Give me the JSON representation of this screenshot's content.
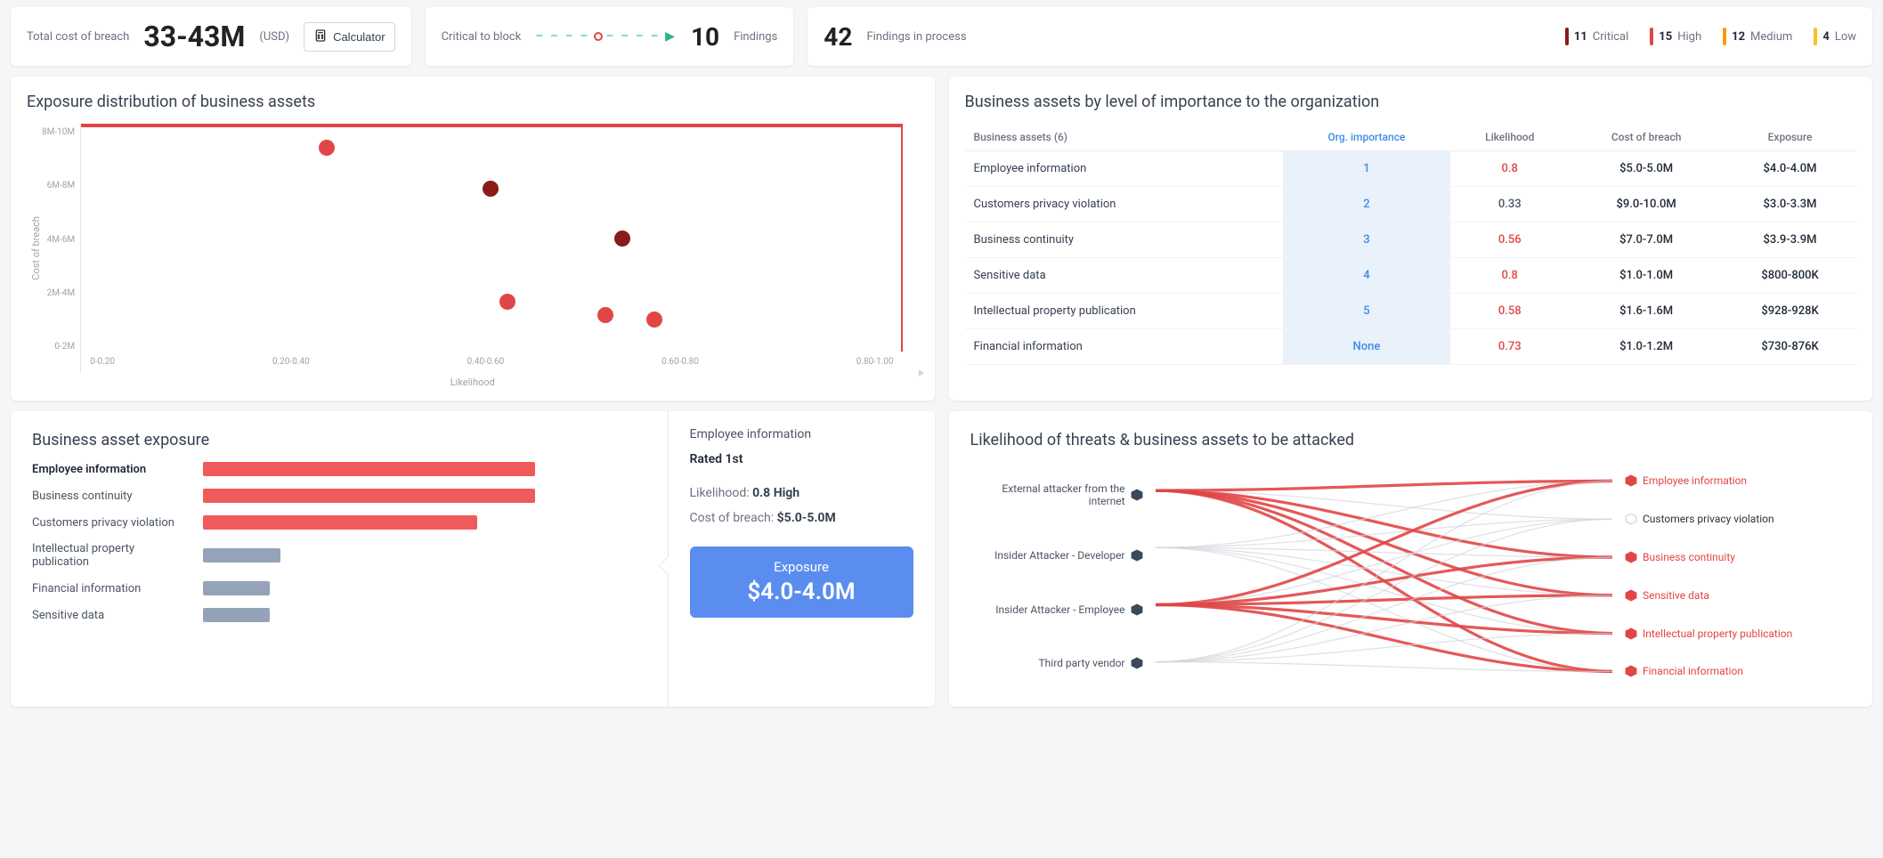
{
  "top": {
    "total_cost_label": "Total cost of breach",
    "total_cost_value": "33-43M",
    "total_cost_unit": "(USD)",
    "calculator_label": "Calculator",
    "critical_block_label": "Critical to block",
    "critical_block_value": "10",
    "findings_label": "Findings",
    "findings_in_process_value": "42",
    "findings_in_process_label": "Findings in process",
    "severities": [
      {
        "count": "11",
        "label": "Critical",
        "color": "#8b1a1a"
      },
      {
        "count": "15",
        "label": "High",
        "color": "#e14646"
      },
      {
        "count": "12",
        "label": "Medium",
        "color": "#f59e0b"
      },
      {
        "count": "4",
        "label": "Low",
        "color": "#fbbf24"
      }
    ]
  },
  "scatter_panel": {
    "title": "Exposure distribution of business assets",
    "x_label": "Likelihood",
    "y_label": "Cost of breach",
    "x_ticks": [
      "0-0.20",
      "0.20-0.40",
      "0.40-0.60",
      "0.60-0.80",
      "0.80-1.00"
    ],
    "y_ticks": [
      "8M-10M",
      "6M-8M",
      "4M-6M",
      "2M-4M",
      "0-2M"
    ]
  },
  "chart_data": [
    {
      "type": "scatter",
      "panel": "exposure_distribution",
      "title": "Exposure distribution of business assets",
      "xlabel": "Likelihood",
      "ylabel": "Cost of breach",
      "xlim": [
        0,
        1
      ],
      "ylim": [
        0,
        10
      ],
      "y_unit": "M",
      "series": [
        {
          "name": "assets",
          "points": [
            {
              "x": 0.3,
              "y": 9.0,
              "color": "#e14646"
            },
            {
              "x": 0.5,
              "y": 7.2,
              "color": "#8b1a1a"
            },
            {
              "x": 0.66,
              "y": 5.0,
              "color": "#8b1a1a"
            },
            {
              "x": 0.52,
              "y": 2.2,
              "color": "#e14646"
            },
            {
              "x": 0.64,
              "y": 1.6,
              "color": "#e14646"
            },
            {
              "x": 0.7,
              "y": 1.4,
              "color": "#e14646"
            }
          ]
        }
      ]
    },
    {
      "type": "bar",
      "panel": "business_asset_exposure",
      "title": "Business asset exposure",
      "categories": [
        "Employee information",
        "Business continuity",
        "Customers privacy violation",
        "Intellectual property publication",
        "Financial information",
        "Sensitive data"
      ],
      "values": [
        4.0,
        4.0,
        3.3,
        0.93,
        0.8,
        0.8
      ],
      "colors": [
        "#ef5b5b",
        "#ef5b5b",
        "#ef5b5b",
        "#94a3b8",
        "#94a3b8",
        "#94a3b8"
      ],
      "unit": "M",
      "selected_index": 0
    }
  ],
  "assets_table": {
    "title": "Business assets by level of importance to the organization",
    "count_header": "Business assets (6)",
    "cols": {
      "importance": "Org. importance",
      "likelihood": "Likelihood",
      "cost": "Cost of breach",
      "exposure": "Exposure"
    },
    "rows": [
      {
        "name": "Employee information",
        "imp": "1",
        "like": "0.8",
        "like_red": true,
        "cost": "$5.0-5.0M",
        "expo": "$4.0-4.0M"
      },
      {
        "name": "Customers privacy violation",
        "imp": "2",
        "like": "0.33",
        "like_red": false,
        "cost": "$9.0-10.0M",
        "expo": "$3.0-3.3M"
      },
      {
        "name": "Business continuity",
        "imp": "3",
        "like": "0.56",
        "like_red": true,
        "cost": "$7.0-7.0M",
        "expo": "$3.9-3.9M"
      },
      {
        "name": "Sensitive data",
        "imp": "4",
        "like": "0.8",
        "like_red": true,
        "cost": "$1.0-1.0M",
        "expo": "$800-800K"
      },
      {
        "name": "Intellectual property publication",
        "imp": "5",
        "like": "0.58",
        "like_red": true,
        "cost": "$1.6-1.6M",
        "expo": "$928-928K"
      },
      {
        "name": "Financial information",
        "imp": "None",
        "like": "0.73",
        "like_red": true,
        "cost": "$1.0-1.2M",
        "expo": "$730-876K"
      }
    ]
  },
  "exposure_panel": {
    "title": "Business asset exposure",
    "detail": {
      "name": "Employee information",
      "rank": "Rated 1st",
      "likelihood_label": "Likelihood:",
      "likelihood_value": "0.8 High",
      "cost_label": "Cost of breach:",
      "cost_value": "$5.0-5.0M",
      "exposure_title": "Exposure",
      "exposure_value": "$4.0-4.0M"
    }
  },
  "sankey_panel": {
    "title": "Likelihood of threats & business assets to be attacked",
    "left": [
      "External attacker from the internet",
      "Insider Attacker - Developer",
      "Insider Attacker - Employee",
      "Third party vendor"
    ],
    "right": [
      {
        "label": "Employee information",
        "hot": true
      },
      {
        "label": "Customers privacy violation",
        "hot": false
      },
      {
        "label": "Business continuity",
        "hot": true
      },
      {
        "label": "Sensitive data",
        "hot": true
      },
      {
        "label": "Intellectual property publication",
        "hot": true
      },
      {
        "label": "Financial information",
        "hot": true
      }
    ]
  }
}
